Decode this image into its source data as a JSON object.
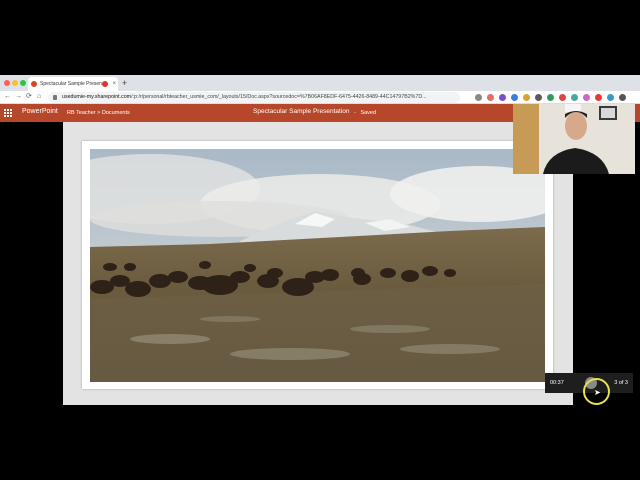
{
  "browser": {
    "tab_title": "Spectacular Sample Presen",
    "tab_close": "×",
    "new_tab": "+",
    "nav": {
      "back": "←",
      "forward": "→",
      "reload": "⟳",
      "home": "⌂"
    },
    "url_host": "usedumie-my.sharepoint.com",
    "url_path": "/:p:/r/personal/rbteacher_usmie_com/_layouts/15/Doc.aspx?sourcedoc=%7B06AF8EDF-6475-4426-8489-44C14797B2%7D..."
  },
  "powerpoint": {
    "app_name": "PowerPoint",
    "breadcrumb": "RB Teacher > Documents",
    "document_title": "Spectacular Sample Presentation",
    "separator": "-",
    "save_status": "Saved"
  },
  "player": {
    "elapsed": "00:37",
    "slide_counter": "3 of 3"
  },
  "colors": {
    "ppt_brand": "#b7472a",
    "cursor_highlight": "#e6e24a"
  },
  "icons": [
    "app-launcher-icon",
    "favicon-icon",
    "recording-icon",
    "close-icon",
    "back-icon",
    "forward-icon",
    "reload-icon",
    "home-icon",
    "lock-icon",
    "play-icon",
    "pointer-icon"
  ]
}
